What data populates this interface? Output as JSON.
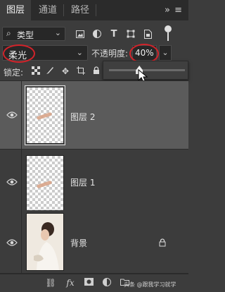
{
  "tabs": [
    {
      "label": "图层",
      "active": true
    },
    {
      "label": "通道",
      "active": false
    },
    {
      "label": "路径",
      "active": false
    }
  ],
  "tab_menu": "»  ≡",
  "filter": {
    "kind_label": "类型",
    "icons": [
      "image-filter-icon",
      "adjustment-filter-icon",
      "type-filter-icon",
      "shape-filter-icon",
      "smart-object-filter-icon",
      "filter-toggle-icon"
    ]
  },
  "blend_mode": {
    "value": "柔光"
  },
  "opacity": {
    "label": "不透明度:",
    "value": "40%",
    "level": 0.4
  },
  "lock": {
    "label": "锁定:",
    "icons": [
      "lock-pixels-icon",
      "lock-image-icon",
      "lock-position-icon",
      "lock-artboard-icon",
      "lock-all-icon"
    ]
  },
  "layers": [
    {
      "name": "图层 2",
      "selected": true,
      "visible": true,
      "thumb": "transparent-stroke"
    },
    {
      "name": "图层 1",
      "selected": false,
      "visible": true,
      "thumb": "transparent-stroke"
    },
    {
      "name": "背景",
      "selected": false,
      "visible": true,
      "locked": true,
      "thumb": "photo"
    }
  ],
  "bottom": {
    "icons": [
      "link-icon",
      "fx-icon",
      "mask-icon",
      "adjustment-icon",
      "group-folder-icon",
      "new-layer-icon",
      "delete-icon"
    ],
    "fx_label": "fx",
    "watermark": "头条 @跟我学习就学"
  },
  "colors": {
    "panel": "#3c3c3c",
    "selected": "#5b5b5b",
    "annotation_red": "#d3232a"
  }
}
